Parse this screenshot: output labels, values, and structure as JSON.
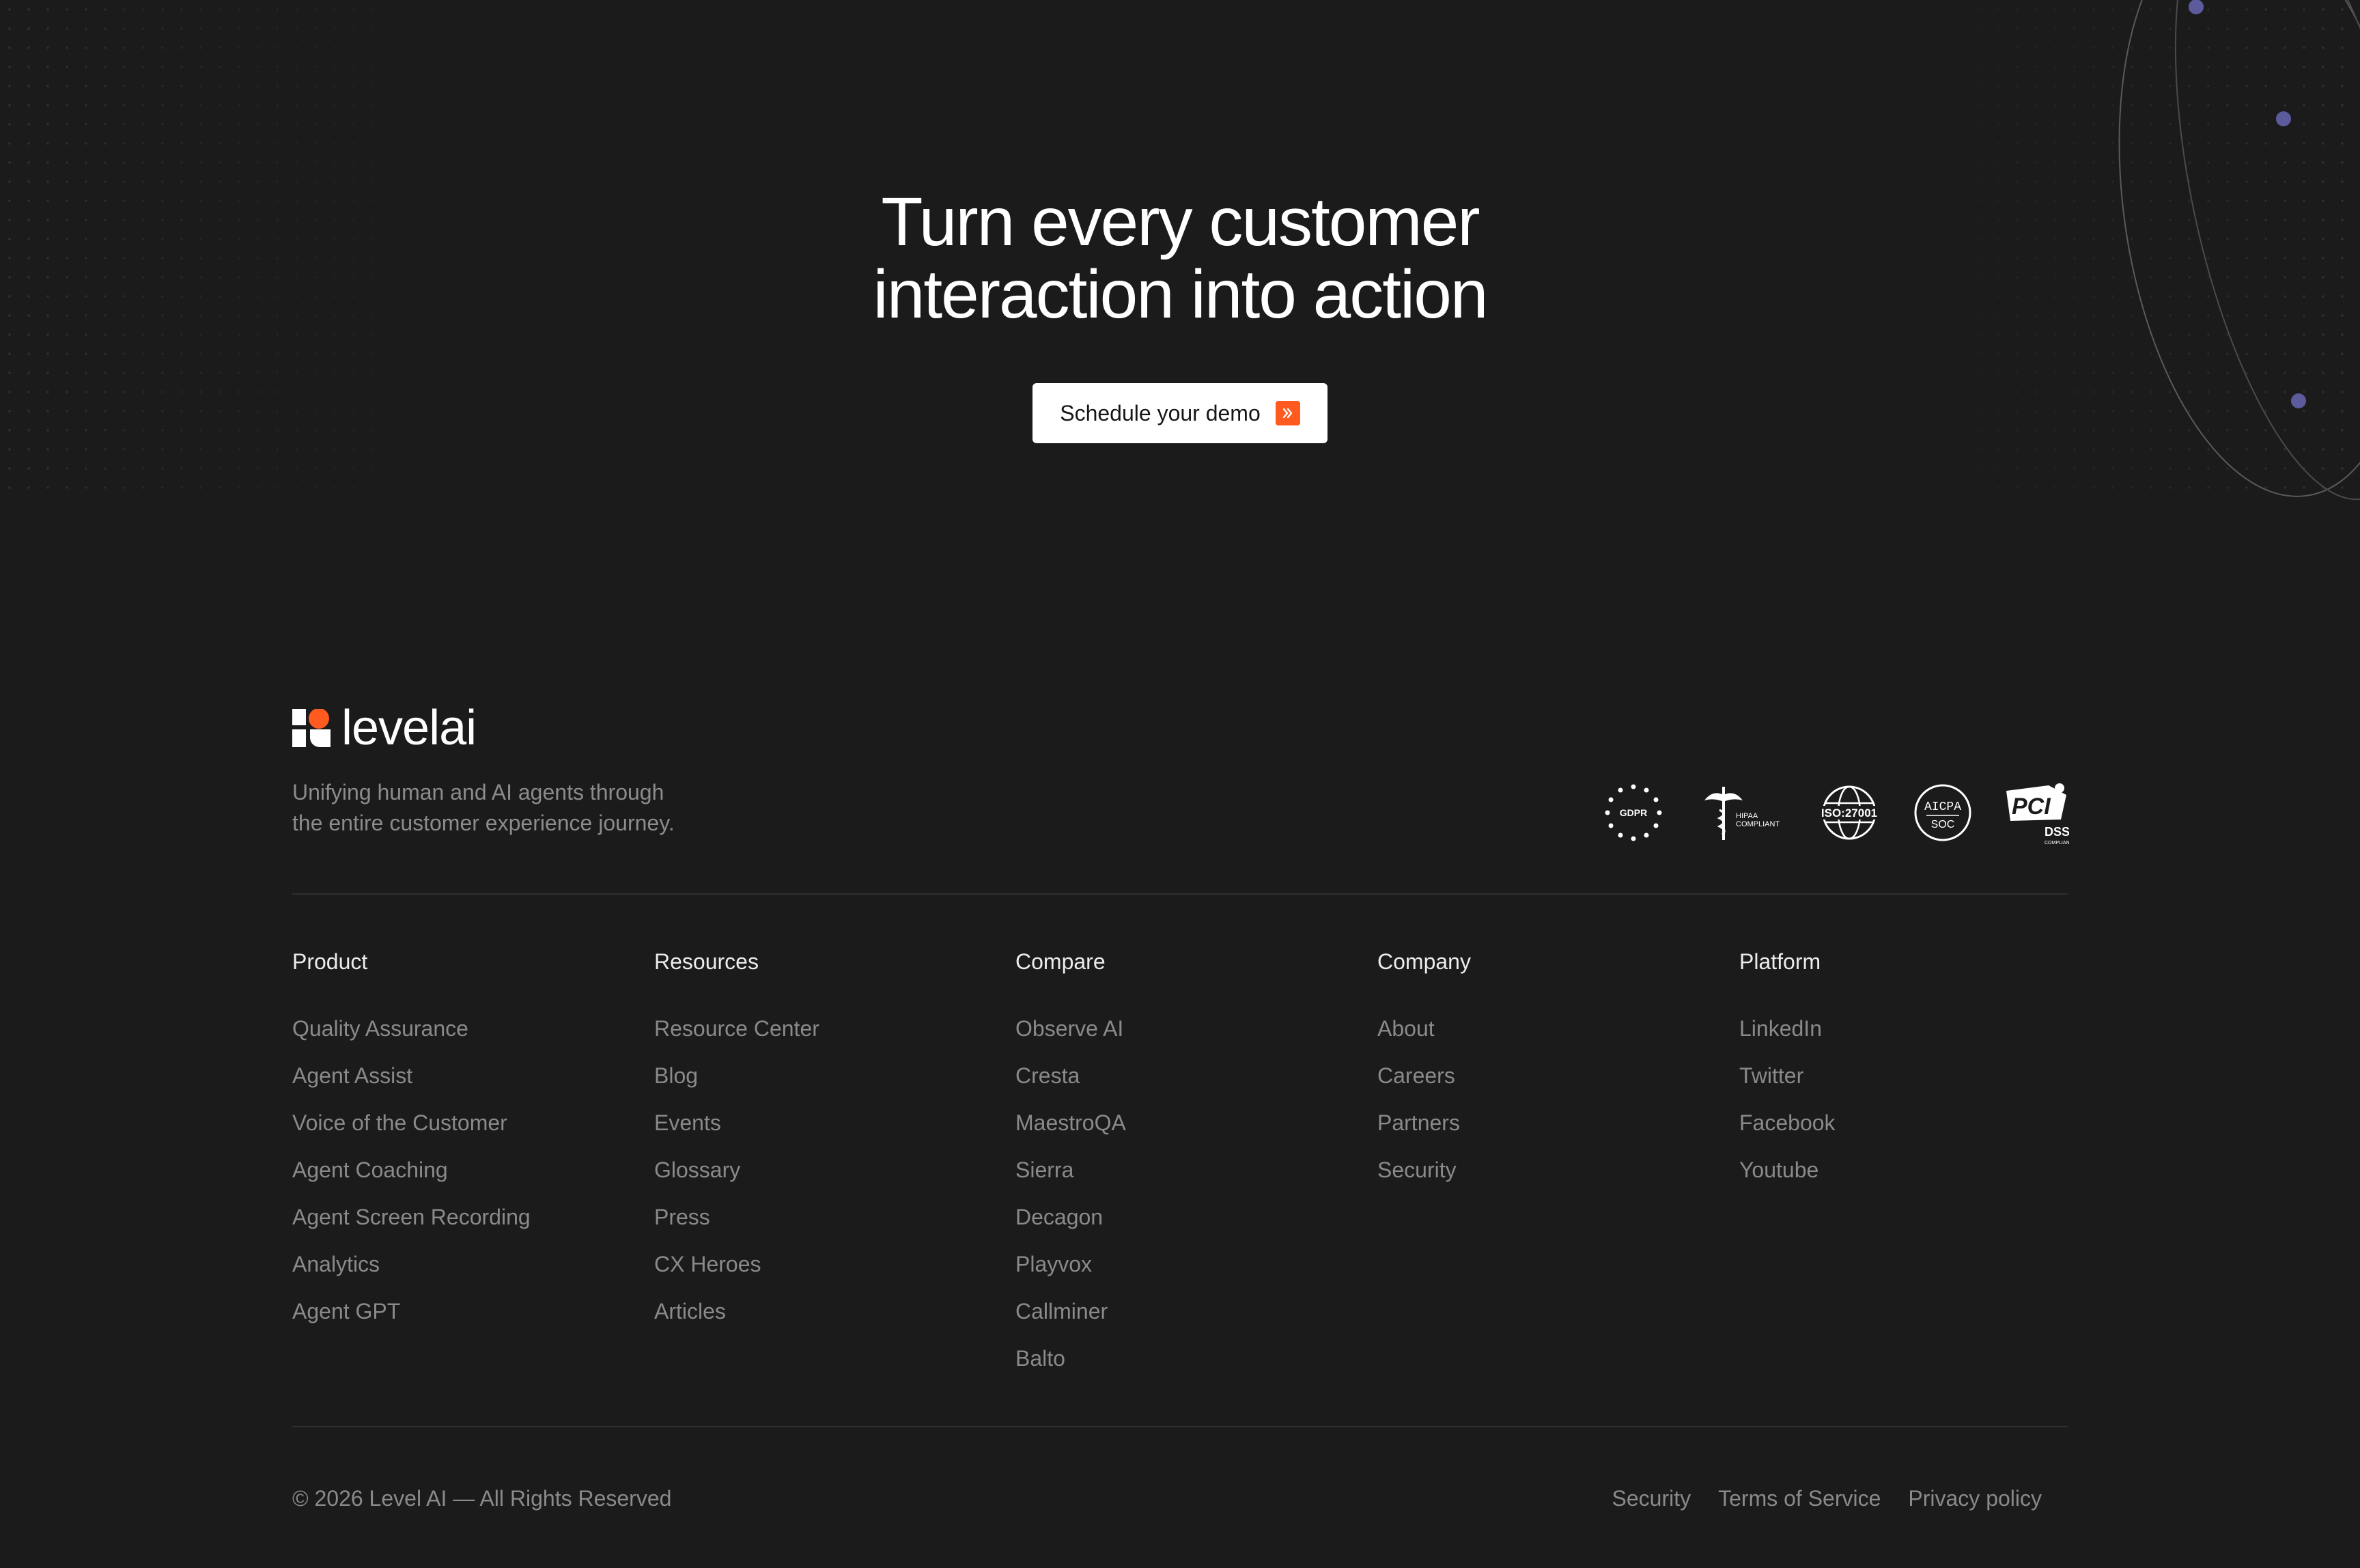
{
  "hero": {
    "headline_line1": "Turn every customer",
    "headline_line2": "interaction into action",
    "cta_label": "Schedule your demo"
  },
  "brand": {
    "name": "levelai",
    "tagline_line1": "Unifying human and AI agents through",
    "tagline_line2": "the entire customer experience journey.",
    "accent_color": "#ff5a1f"
  },
  "compliance_badges": [
    {
      "label": "GDPR",
      "icon": "gdpr-badge-icon"
    },
    {
      "label": "HIPAA COMPLIANT",
      "icon": "hipaa-badge-icon"
    },
    {
      "label": "ISO:27001",
      "icon": "iso-27001-badge-icon"
    },
    {
      "label": "AICPA SOC",
      "icon": "aicpa-soc-badge-icon"
    },
    {
      "label": "PCI DSS",
      "icon": "pci-dss-badge-icon"
    }
  ],
  "footer": {
    "columns": [
      {
        "title": "Product",
        "links": [
          "Quality Assurance",
          "Agent Assist",
          "Voice of the Customer",
          "Agent Coaching",
          "Agent Screen Recording",
          "Analytics",
          "Agent GPT"
        ]
      },
      {
        "title": "Resources",
        "links": [
          "Resource Center",
          "Blog",
          "Events",
          "Glossary",
          "Press",
          "CX Heroes",
          "Articles"
        ]
      },
      {
        "title": "Compare",
        "links": [
          "Observe AI",
          "Cresta",
          "MaestroQA",
          "Sierra",
          "Decagon",
          "Playvox",
          "Callminer",
          "Balto"
        ]
      },
      {
        "title": "Company",
        "links": [
          "About",
          "Careers",
          "Partners",
          "Security"
        ]
      },
      {
        "title": "Platform",
        "links": [
          "LinkedIn",
          "Twitter",
          "Facebook",
          "Youtube"
        ]
      }
    ],
    "copyright": "© 2026 Level AI — All Rights Reserved",
    "legal_links": [
      "Security",
      "Terms of Service",
      "Privacy policy"
    ]
  }
}
